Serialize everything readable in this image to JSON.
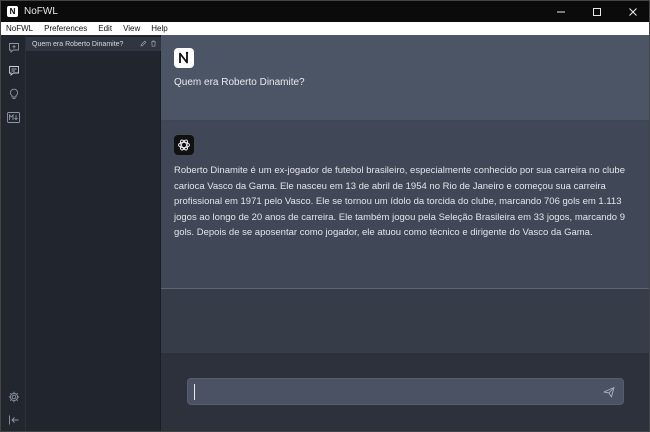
{
  "window": {
    "title": "NoFWL",
    "icon_letter": "N"
  },
  "menu": [
    "NoFWL",
    "Preferences",
    "Edit",
    "View",
    "Help"
  ],
  "rail_icons": [
    "new-chat-icon",
    "chat-history-icon",
    "prompt-tips-icon",
    "markdown-download-icon",
    "settings-icon",
    "collapse-sidebar-icon"
  ],
  "sidebar": {
    "chats": [
      {
        "label": "Quem era Roberto Dinamite?"
      }
    ]
  },
  "conversation": {
    "user_message": "Quem era Roberto Dinamite?",
    "assistant_message": "Roberto Dinamite é um ex-jogador de futebol brasileiro, especialmente conhecido por sua carreira no clube carioca Vasco da Gama. Ele nasceu em 13 de abril de 1954 no Rio de Janeiro e começou sua carreira profissional em 1971 pelo Vasco. Ele se tornou um ídolo da torcida do clube, marcando 706 gols em 1.113 jogos ao longo de 20 anos de carreira. Ele também jogou pela Seleção Brasileira em 33 jogos, marcando 9 gols. Depois de se aposentar como jogador, ele atuou como técnico e dirigente do Vasco da Gama."
  },
  "composer": {
    "value": "",
    "placeholder": ""
  },
  "colors": {
    "titlebar": "#0b0b0b",
    "sidebar": "#20252e",
    "user_bg": "#4c5566",
    "assistant_bg": "#404857",
    "composer_bg": "#2c313b"
  }
}
